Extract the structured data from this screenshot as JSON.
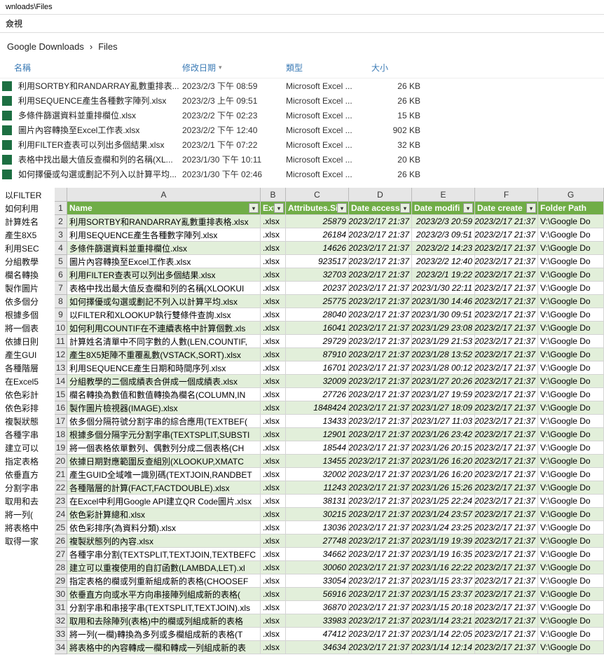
{
  "window": {
    "title_fragment": "wnloads\\Files"
  },
  "menu": {
    "view_fragment": "僉視"
  },
  "breadcrumb": {
    "a": "Google Downloads",
    "b": "Files"
  },
  "columns": {
    "name": "名稱",
    "modified": "修改日期",
    "type": "類型",
    "size": "大小"
  },
  "explorer": [
    {
      "name": "利用SORTBY和RANDARRAY亂數重排表...",
      "date": "2023/2/3 下午 08:59",
      "type": "Microsoft Excel ...",
      "size": "26 KB"
    },
    {
      "name": "利用SEQUENCE產生各種數字陣列.xlsx",
      "date": "2023/2/3 上午 09:51",
      "type": "Microsoft Excel ...",
      "size": "26 KB"
    },
    {
      "name": "多條件篩選資料並重排欄位.xlsx",
      "date": "2023/2/2 下午 02:23",
      "type": "Microsoft Excel ...",
      "size": "15 KB"
    },
    {
      "name": "圖片內容轉換至Excel工作表.xlsx",
      "date": "2023/2/2 下午 12:40",
      "type": "Microsoft Excel ...",
      "size": "902 KB"
    },
    {
      "name": "利用FILTER查表可以列出多個結果.xlsx",
      "date": "2023/2/1 下午 07:22",
      "type": "Microsoft Excel ...",
      "size": "32 KB"
    },
    {
      "name": "表格中找出最大值反查欄和列的名稱(XL...",
      "date": "2023/1/30 下午 10:11",
      "type": "Microsoft Excel ...",
      "size": "20 KB"
    },
    {
      "name": "如何擇優或勾選或劃記不列入以計算平均...",
      "date": "2023/1/30 下午 02:46",
      "type": "Microsoft Excel ...",
      "size": "26 KB"
    }
  ],
  "side_fragments": [
    "以FILTER",
    "如何利用",
    "計算姓名",
    "產生8X5",
    "利用SEC",
    "分組教學",
    "欄名轉換",
    "製作圖片",
    "依多個分",
    "根據多個",
    "將一個表",
    "依據日則",
    "產生GUI",
    "各種階層",
    "在Excel5",
    "依色彩計",
    "依色彩排",
    "複製狀態",
    "各種字串",
    "建立可以",
    "指定表格",
    "依垂直方",
    "分割字串",
    "取用和去",
    "將一列(",
    "將表格中",
    "取得一家"
  ],
  "sheet": {
    "col_letters": [
      "A",
      "B",
      "C",
      "D",
      "E",
      "F",
      "G"
    ],
    "headers": {
      "A": "Name",
      "B": "Exte",
      "C": "Attributes.Si",
      "D": "Date accesse",
      "E": "Date modifi",
      "F": "Date create",
      "G": "Folder Path"
    },
    "rows": [
      {
        "n": 2,
        "a": "利用SORTBY和RANDARRAY亂數重排表格.xlsx",
        "b": ".xlsx",
        "c": "25879",
        "d": "2023/2/17 21:37",
        "e": "2023/2/3 20:59",
        "f": "2023/2/17 21:37",
        "g": "V:\\Google Do"
      },
      {
        "n": 3,
        "a": "利用SEQUENCE產生各種數字陣列.xlsx",
        "b": ".xlsx",
        "c": "26184",
        "d": "2023/2/17 21:37",
        "e": "2023/2/3 09:51",
        "f": "2023/2/17 21:37",
        "g": "V:\\Google Do"
      },
      {
        "n": 4,
        "a": "多條件篩選資料並重排欄位.xlsx",
        "b": ".xlsx",
        "c": "14626",
        "d": "2023/2/17 21:37",
        "e": "2023/2/2 14:23",
        "f": "2023/2/17 21:37",
        "g": "V:\\Google Do"
      },
      {
        "n": 5,
        "a": "圖片內容轉換至Excel工作表.xlsx",
        "b": ".xlsx",
        "c": "923517",
        "d": "2023/2/17 21:37",
        "e": "2023/2/2 12:40",
        "f": "2023/2/17 21:37",
        "g": "V:\\Google Do"
      },
      {
        "n": 6,
        "a": "利用FILTER查表可以列出多個結果.xlsx",
        "b": ".xlsx",
        "c": "32703",
        "d": "2023/2/17 21:37",
        "e": "2023/2/1 19:22",
        "f": "2023/2/17 21:37",
        "g": "V:\\Google Do"
      },
      {
        "n": 7,
        "a": "表格中找出最大值反查欄和列的名稱(XLOOKUI",
        "b": ".xlsx",
        "c": "20237",
        "d": "2023/2/17 21:37",
        "e": "2023/1/30 22:11",
        "f": "2023/2/17 21:37",
        "g": "V:\\Google Do"
      },
      {
        "n": 8,
        "a": "如何擇優或勾選或劃記不列入以計算平均.xlsx",
        "b": ".xlsx",
        "c": "25775",
        "d": "2023/2/17 21:37",
        "e": "2023/1/30 14:46",
        "f": "2023/2/17 21:37",
        "g": "V:\\Google Do"
      },
      {
        "n": 9,
        "a": "以FILTER和XLOOKUP執行雙條件查詢.xlsx",
        "b": ".xlsx",
        "c": "28040",
        "d": "2023/2/17 21:37",
        "e": "2023/1/30 09:51",
        "f": "2023/2/17 21:37",
        "g": "V:\\Google Do"
      },
      {
        "n": 10,
        "a": "如何利用COUNTIF在不連續表格中計算個數.xls",
        "b": ".xlsx",
        "c": "16041",
        "d": "2023/2/17 21:37",
        "e": "2023/1/29 23:08",
        "f": "2023/2/17 21:37",
        "g": "V:\\Google Do"
      },
      {
        "n": 11,
        "a": "計算姓名清單中不同字數的人數(LEN,COUNTIF,",
        "b": ".xlsx",
        "c": "29729",
        "d": "2023/2/17 21:37",
        "e": "2023/1/29 21:53",
        "f": "2023/2/17 21:37",
        "g": "V:\\Google Do"
      },
      {
        "n": 12,
        "a": "產生8X5矩陣不重覆亂數(VSTACK,SORT).xlsx",
        "b": ".xlsx",
        "c": "87910",
        "d": "2023/2/17 21:37",
        "e": "2023/1/28 13:52",
        "f": "2023/2/17 21:37",
        "g": "V:\\Google Do"
      },
      {
        "n": 13,
        "a": "利用SEQUENCE產生日期和時間序列.xlsx",
        "b": ".xlsx",
        "c": "16701",
        "d": "2023/2/17 21:37",
        "e": "2023/1/28 00:12",
        "f": "2023/2/17 21:37",
        "g": "V:\\Google Do"
      },
      {
        "n": 14,
        "a": "分組教學的二個成績表合併成一個成績表.xlsx",
        "b": ".xlsx",
        "c": "32009",
        "d": "2023/2/17 21:37",
        "e": "2023/1/27 20:26",
        "f": "2023/2/17 21:37",
        "g": "V:\\Google Do"
      },
      {
        "n": 15,
        "a": "欄名轉換為數值和數值轉換為欄名(COLUMN,IN",
        "b": ".xlsx",
        "c": "27726",
        "d": "2023/2/17 21:37",
        "e": "2023/1/27 19:59",
        "f": "2023/2/17 21:37",
        "g": "V:\\Google Do"
      },
      {
        "n": 16,
        "a": "製作圖片檢視器(IMAGE).xlsx",
        "b": ".xlsx",
        "c": "1848424",
        "d": "2023/2/17 21:37",
        "e": "2023/1/27 18:09",
        "f": "2023/2/17 21:37",
        "g": "V:\\Google Do"
      },
      {
        "n": 17,
        "a": "依多個分隔符號分割字串的綜合應用(TEXTBEF(",
        "b": ".xlsx",
        "c": "13433",
        "d": "2023/2/17 21:37",
        "e": "2023/1/27 11:03",
        "f": "2023/2/17 21:37",
        "g": "V:\\Google Do"
      },
      {
        "n": 18,
        "a": "根據多個分隔字元分割字串(TEXTSPLIT,SUBSTI",
        "b": ".xlsx",
        "c": "12901",
        "d": "2023/2/17 21:37",
        "e": "2023/1/26 23:42",
        "f": "2023/2/17 21:37",
        "g": "V:\\Google Do"
      },
      {
        "n": 19,
        "a": "將一個表格依單數列、偶數列分成二個表格(CH",
        "b": ".xlsx",
        "c": "18544",
        "d": "2023/2/17 21:37",
        "e": "2023/1/26 20:15",
        "f": "2023/2/17 21:37",
        "g": "V:\\Google Do"
      },
      {
        "n": 20,
        "a": "依據日期對應範圍反查組別(XLOOKUP,XMATC",
        "b": ".xlsx",
        "c": "13455",
        "d": "2023/2/17 21:37",
        "e": "2023/1/26 16:20",
        "f": "2023/2/17 21:37",
        "g": "V:\\Google Do"
      },
      {
        "n": 21,
        "a": "產生GUID全域唯一識別碼(TEXTJOIN,RANDBET",
        "b": ".xlsx",
        "c": "32002",
        "d": "2023/2/17 21:37",
        "e": "2023/1/26 16:20",
        "f": "2023/2/17 21:37",
        "g": "V:\\Google Do"
      },
      {
        "n": 22,
        "a": "各種階層的計算(FACT,FACTDOUBLE).xlsx",
        "b": ".xlsx",
        "c": "11243",
        "d": "2023/2/17 21:37",
        "e": "2023/1/26 15:26",
        "f": "2023/2/17 21:37",
        "g": "V:\\Google Do"
      },
      {
        "n": 23,
        "a": "在Excel中利用Google API建立QR Code圖片.xlsx",
        "b": ".xlsx",
        "c": "38131",
        "d": "2023/2/17 21:37",
        "e": "2023/1/25 22:24",
        "f": "2023/2/17 21:37",
        "g": "V:\\Google Do"
      },
      {
        "n": 24,
        "a": "依色彩計算總和.xlsx",
        "b": ".xlsx",
        "c": "30215",
        "d": "2023/2/17 21:37",
        "e": "2023/1/24 23:57",
        "f": "2023/2/17 21:37",
        "g": "V:\\Google Do"
      },
      {
        "n": 25,
        "a": "依色彩排序(為資料分類).xlsx",
        "b": ".xlsx",
        "c": "13036",
        "d": "2023/2/17 21:37",
        "e": "2023/1/24 23:25",
        "f": "2023/2/17 21:37",
        "g": "V:\\Google Do"
      },
      {
        "n": 26,
        "a": "複製狀態列的內容.xlsx",
        "b": ".xlsx",
        "c": "27748",
        "d": "2023/2/17 21:37",
        "e": "2023/1/19 19:39",
        "f": "2023/2/17 21:37",
        "g": "V:\\Google Do"
      },
      {
        "n": 27,
        "a": "各種字串分割(TEXTSPLIT,TEXTJOIN,TEXTBEFC",
        "b": ".xlsx",
        "c": "34662",
        "d": "2023/2/17 21:37",
        "e": "2023/1/19 16:35",
        "f": "2023/2/17 21:37",
        "g": "V:\\Google Do"
      },
      {
        "n": 28,
        "a": "建立可以重複使用的自訂函數(LAMBDA,LET).xl",
        "b": ".xlsx",
        "c": "30060",
        "d": "2023/2/17 21:37",
        "e": "2023/1/16 22:22",
        "f": "2023/2/17 21:37",
        "g": "V:\\Google Do"
      },
      {
        "n": 29,
        "a": "指定表格的欄或列重新組成新的表格(CHOOSEF",
        "b": ".xlsx",
        "c": "33054",
        "d": "2023/2/17 21:37",
        "e": "2023/1/15 23:37",
        "f": "2023/2/17 21:37",
        "g": "V:\\Google Do"
      },
      {
        "n": 30,
        "a": "依垂直方向或水平方向串接陣列組成新的表格(",
        "b": ".xlsx",
        "c": "56916",
        "d": "2023/2/17 21:37",
        "e": "2023/1/15 23:37",
        "f": "2023/2/17 21:37",
        "g": "V:\\Google Do"
      },
      {
        "n": 31,
        "a": "分割字串和串接字串(TEXTSPLIT,TEXTJOIN).xls",
        "b": ".xlsx",
        "c": "36870",
        "d": "2023/2/17 21:37",
        "e": "2023/1/15 20:18",
        "f": "2023/2/17 21:37",
        "g": "V:\\Google Do"
      },
      {
        "n": 32,
        "a": "取用和去除陣列(表格)中的欄或列組成新的表格",
        "b": ".xlsx",
        "c": "33983",
        "d": "2023/2/17 21:37",
        "e": "2023/1/14 23:21",
        "f": "2023/2/17 21:37",
        "g": "V:\\Google Do"
      },
      {
        "n": 33,
        "a": "將一列(一欄)轉換為多列或多欄組成新的表格(T",
        "b": ".xlsx",
        "c": "47412",
        "d": "2023/2/17 21:37",
        "e": "2023/1/14 22:05",
        "f": "2023/2/17 21:37",
        "g": "V:\\Google Do"
      },
      {
        "n": 34,
        "a": "將表格中的內容轉成一欄和轉成一列組成新的表",
        "b": ".xlsx",
        "c": "34634",
        "d": "2023/2/17 21:37",
        "e": "2023/1/14 12:14",
        "f": "2023/2/17 21:37",
        "g": "V:\\Google Do"
      }
    ]
  }
}
